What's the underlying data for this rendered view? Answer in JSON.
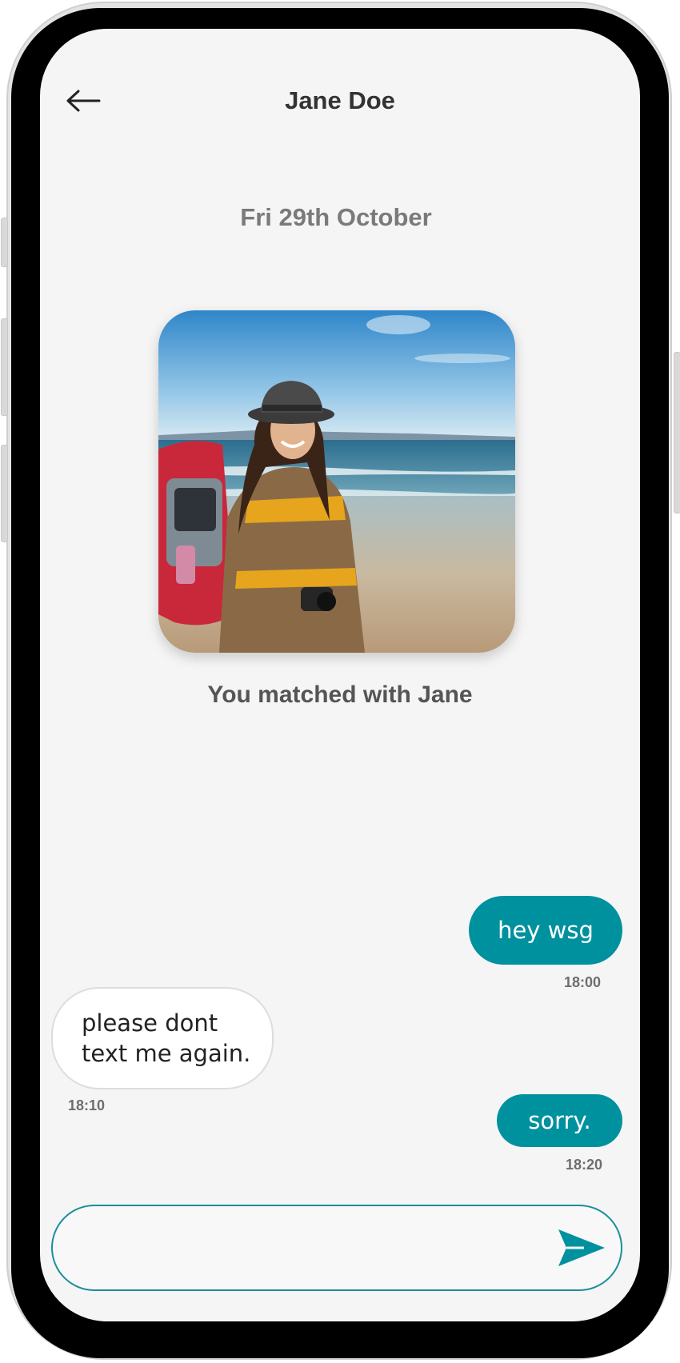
{
  "header": {
    "title": "Jane Doe",
    "back_icon": "arrow-left-icon"
  },
  "date_label": "Fri 29th October",
  "match": {
    "photo_alt": "Jane Doe",
    "text": "You matched with Jane"
  },
  "messages": [
    {
      "direction": "outgoing",
      "text": "hey wsg",
      "time": "18:00"
    },
    {
      "direction": "incoming",
      "text": "please dont text me again.",
      "time": "18:10"
    },
    {
      "direction": "outgoing",
      "text": "sorry.",
      "time": "18:20"
    }
  ],
  "composer": {
    "value": "",
    "placeholder": "",
    "send_icon": "send-icon"
  },
  "colors": {
    "accent": "#00919f",
    "screen_bg": "#f5f5f5",
    "title": "#333333",
    "date": "#7a7a7a"
  }
}
